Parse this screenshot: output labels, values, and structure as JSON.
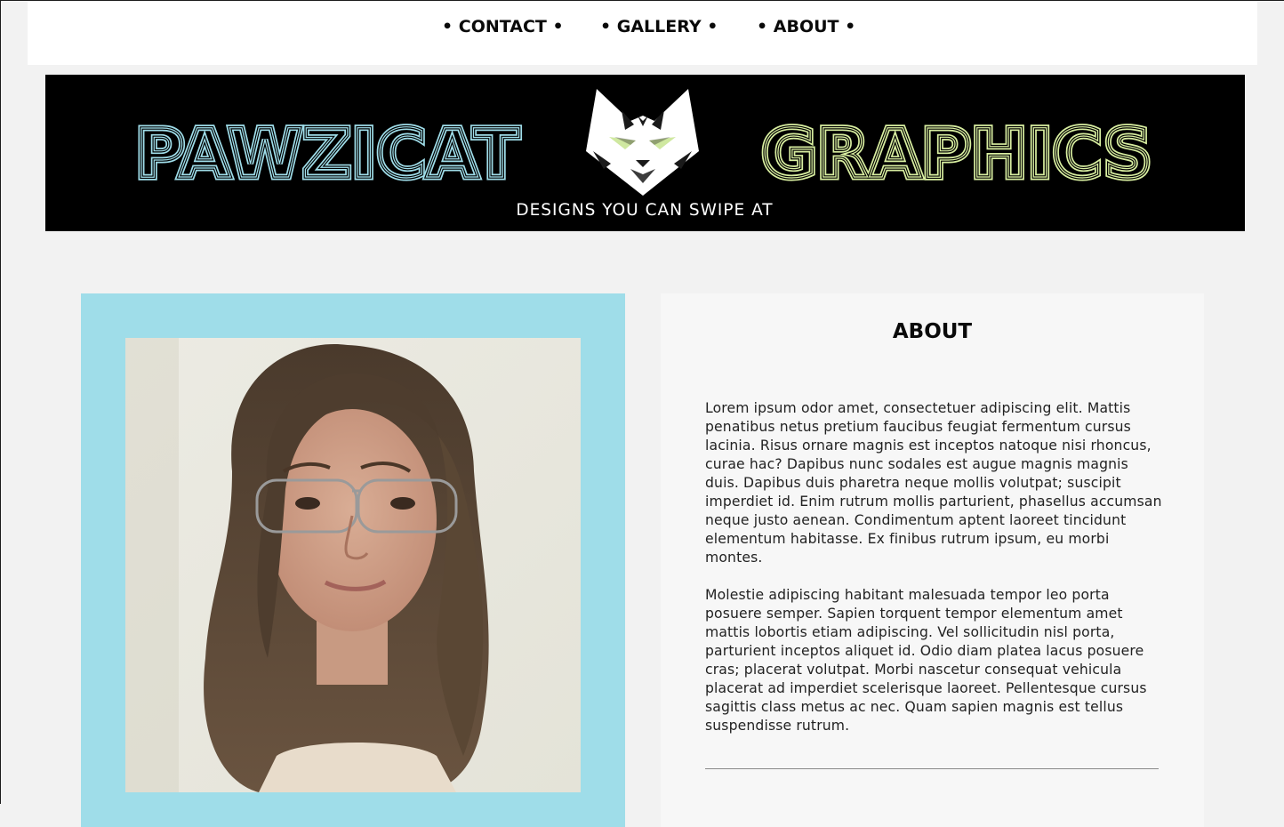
{
  "nav": {
    "items": [
      {
        "label": "• CONTACT •"
      },
      {
        "label": "• GALLERY •"
      },
      {
        "label": "• ABOUT •"
      }
    ]
  },
  "banner": {
    "brand_left": "PAWZICAT",
    "brand_right": "GRAPHICS",
    "tagline": "DESIGNS YOU CAN SWIPE AT",
    "logo_icon": "cat-head-icon",
    "colors": {
      "background": "#000000",
      "left_text": "#9fdde9",
      "right_text": "#d8eea0",
      "cat_face": "#ffffff",
      "cat_eyes": "#cfe8a0"
    }
  },
  "photo": {
    "panel_color": "#9fdde9"
  },
  "about": {
    "heading": "ABOUT",
    "paragraphs": [
      "  Lorem ipsum odor amet, consectetuer adipiscing elit. Mattis penatibus netus pretium faucibus feugiat fermentum cursus lacinia. Risus ornare magnis est inceptos natoque nisi rhoncus, curae hac? Dapibus nunc sodales est augue magnis magnis duis. Dapibus duis pharetra neque mollis volutpat; suscipit imperdiet id. Enim rutrum mollis parturient, phasellus accumsan neque justo aenean. Condimentum aptent laoreet tincidunt elementum habitasse. Ex finibus rutrum ipsum, eu morbi montes.",
      "Molestie adipiscing habitant malesuada tempor leo porta posuere semper. Sapien torquent tempor elementum amet mattis lobortis etiam adipiscing. Vel sollicitudin nisl porta, parturient inceptos aliquet id. Odio diam platea lacus posuere cras; placerat volutpat. Morbi nascetur consequat vehicula placerat ad imperdiet scelerisque laoreet. Pellentesque cursus sagittis class metus ac nec. Quam sapien magnis est tellus suspendisse rutrum."
    ]
  }
}
